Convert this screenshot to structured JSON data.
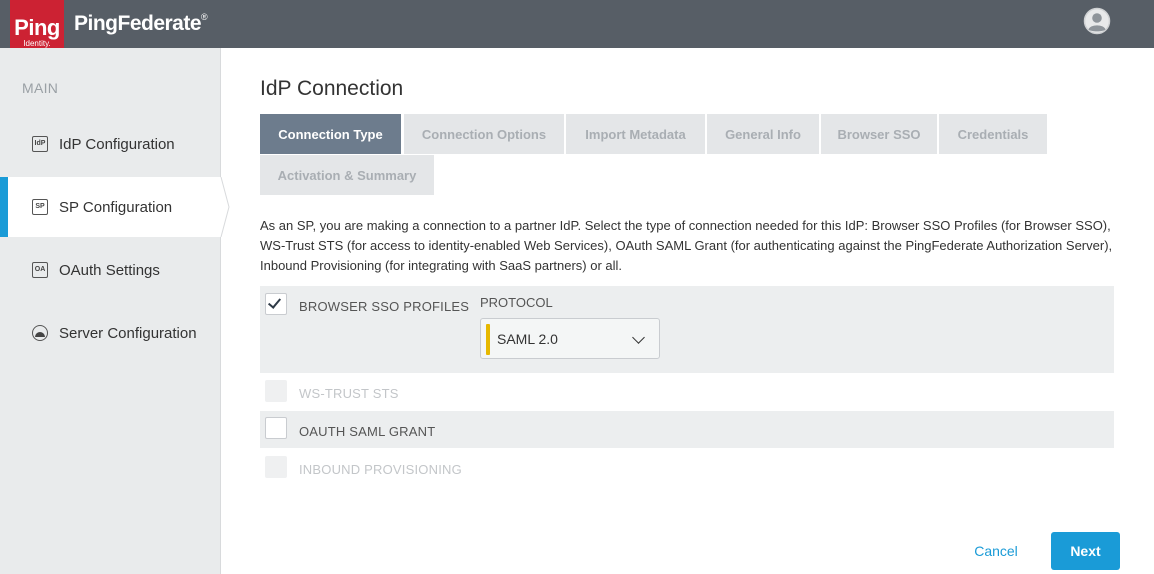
{
  "header": {
    "logo_text": "Ping",
    "logo_subtext": "Identity.",
    "product_name": "PingFederate",
    "registered_mark": "®",
    "user_icon": "user-avatar-icon"
  },
  "sidebar": {
    "heading": "MAIN",
    "items": [
      {
        "label": "IdP Configuration",
        "icon_text": "IdP",
        "icon": "idp-icon",
        "active": false
      },
      {
        "label": "SP Configuration",
        "icon_text": "SP",
        "icon": "sp-icon",
        "active": true
      },
      {
        "label": "OAuth Settings",
        "icon_text": "OA",
        "icon": "oauth-icon",
        "active": false
      },
      {
        "label": "Server Configuration",
        "icon_text": "",
        "icon": "server-icon",
        "active": false
      }
    ]
  },
  "main": {
    "title": "IdP Connection",
    "tabs": [
      {
        "label": "Connection Type",
        "active": true
      },
      {
        "label": "Connection Options",
        "active": false
      },
      {
        "label": "Import Metadata",
        "active": false
      },
      {
        "label": "General Info",
        "active": false
      },
      {
        "label": "Browser SSO",
        "active": false
      },
      {
        "label": "Credentials",
        "active": false
      },
      {
        "label": "Activation & Summary",
        "active": false
      }
    ],
    "description": "As an SP, you are making a connection to a partner IdP. Select the type of connection needed for this IdP: Browser SSO Profiles (for Browser SSO), WS-Trust STS (for access to identity-enabled Web Services), OAuth SAML Grant (for authenticating against the PingFederate Authorization Server), Inbound Provisioning (for integrating with SaaS partners) or all.",
    "options": [
      {
        "label": "BROWSER SSO PROFILES",
        "checked": true,
        "disabled": false
      },
      {
        "label": "WS-TRUST STS",
        "checked": false,
        "disabled": true
      },
      {
        "label": "OAUTH SAML GRANT",
        "checked": false,
        "disabled": false
      },
      {
        "label": "INBOUND PROVISIONING",
        "checked": false,
        "disabled": true
      }
    ],
    "protocol": {
      "label": "PROTOCOL",
      "value": "SAML 2.0"
    }
  },
  "footer": {
    "cancel_label": "Cancel",
    "next_label": "Next"
  },
  "colors": {
    "topbar": "#575e66",
    "brand_red": "#cc2233",
    "accent_blue": "#1a9bd7",
    "active_tab": "#6d7c8d",
    "select_accent": "#e6b800"
  }
}
